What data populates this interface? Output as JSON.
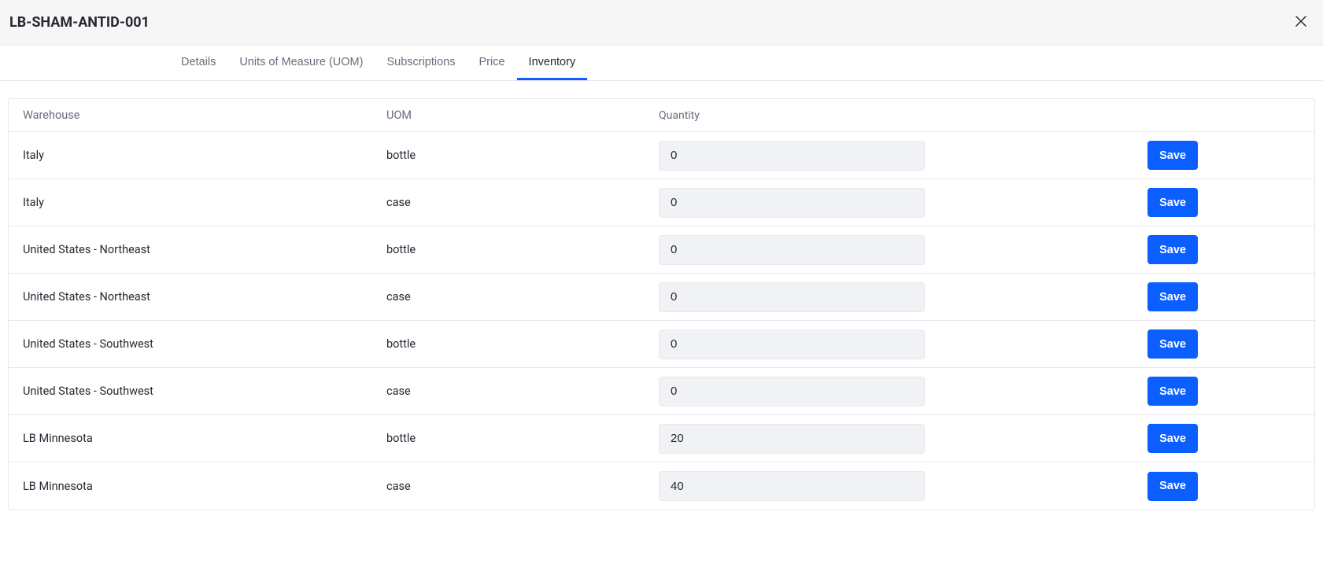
{
  "header": {
    "title": "LB-SHAM-ANTID-001"
  },
  "tabs": [
    {
      "label": "Details",
      "active": false
    },
    {
      "label": "Units of Measure (UOM)",
      "active": false
    },
    {
      "label": "Subscriptions",
      "active": false
    },
    {
      "label": "Price",
      "active": false
    },
    {
      "label": "Inventory",
      "active": true
    }
  ],
  "table": {
    "columns": {
      "warehouse": "Warehouse",
      "uom": "UOM",
      "quantity": "Quantity"
    },
    "save_label": "Save",
    "rows": [
      {
        "warehouse": "Italy",
        "uom": "bottle",
        "quantity": "0"
      },
      {
        "warehouse": "Italy",
        "uom": "case",
        "quantity": "0"
      },
      {
        "warehouse": "United States - Northeast",
        "uom": "bottle",
        "quantity": "0"
      },
      {
        "warehouse": "United States - Northeast",
        "uom": "case",
        "quantity": "0"
      },
      {
        "warehouse": "United States - Southwest",
        "uom": "bottle",
        "quantity": "0"
      },
      {
        "warehouse": "United States - Southwest",
        "uom": "case",
        "quantity": "0"
      },
      {
        "warehouse": "LB Minnesota",
        "uom": "bottle",
        "quantity": "20"
      },
      {
        "warehouse": "LB Minnesota",
        "uom": "case",
        "quantity": "40"
      }
    ]
  }
}
